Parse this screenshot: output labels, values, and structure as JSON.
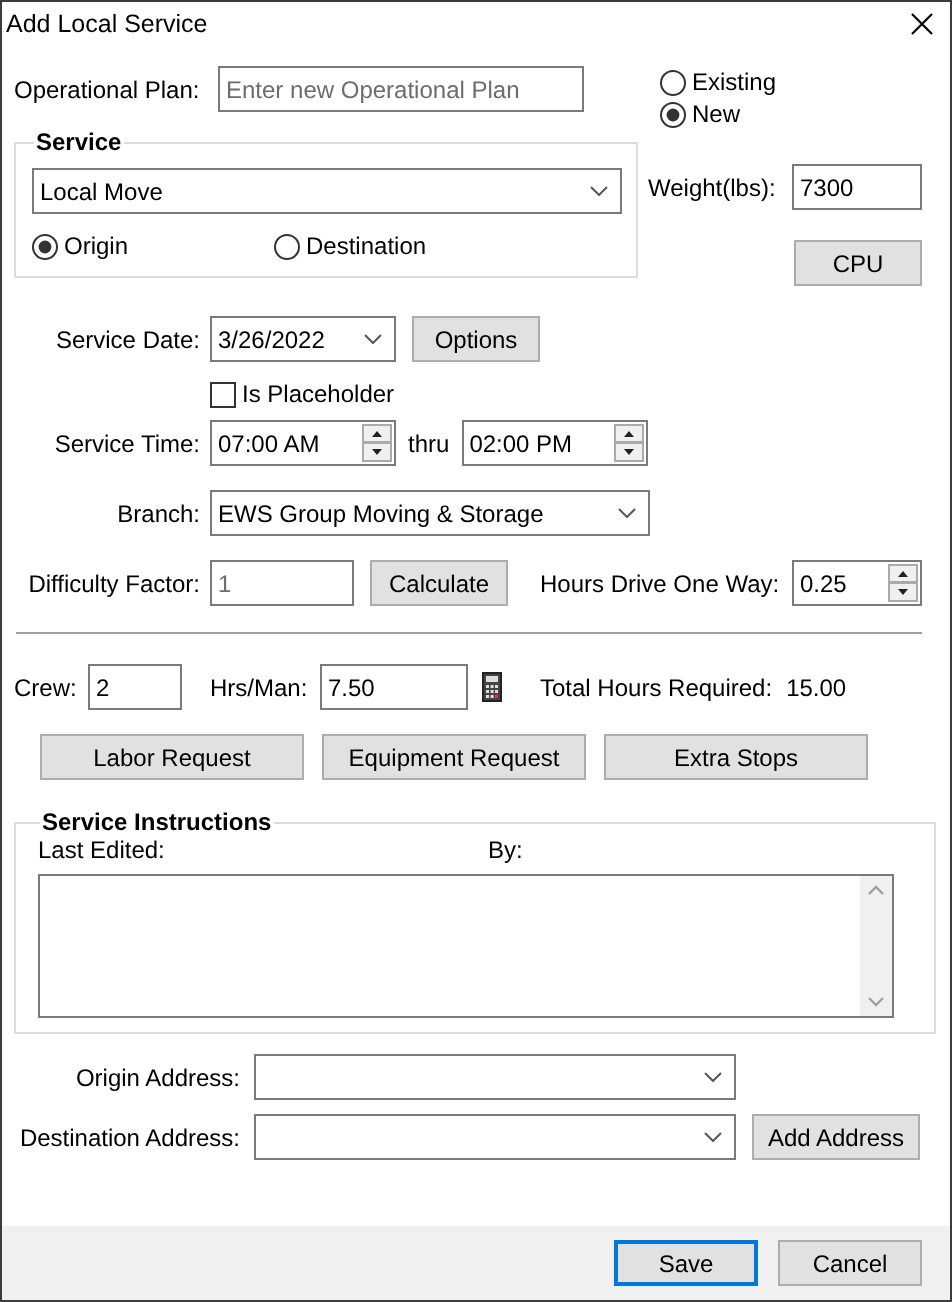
{
  "window": {
    "title": "Add Local Service"
  },
  "operational_plan": {
    "label": "Operational Plan:",
    "placeholder": "Enter new Operational Plan"
  },
  "plan_mode": [
    {
      "label": "Existing",
      "selected": false
    },
    {
      "label": "New",
      "selected": true
    }
  ],
  "service": {
    "title": "Service",
    "type": "Local Move",
    "location": [
      {
        "label": "Origin",
        "selected": true
      },
      {
        "label": "Destination",
        "selected": false
      }
    ]
  },
  "weight": {
    "label": "Weight(lbs):",
    "value": "7300"
  },
  "cpu_button": "CPU",
  "service_date": {
    "label": "Service Date:",
    "value": "3/26/2022"
  },
  "options_button": "Options",
  "is_placeholder": {
    "label": "Is Placeholder",
    "checked": false
  },
  "service_time": {
    "label": "Service Time:",
    "from": "07:00 AM",
    "thru": "thru",
    "to": "02:00 PM"
  },
  "branch": {
    "label": "Branch:",
    "value": "EWS Group Moving & Storage"
  },
  "difficulty": {
    "label": "Difficulty Factor:",
    "placeholder": "1"
  },
  "calculate_button": "Calculate",
  "hours_drive": {
    "label": "Hours Drive One Way:",
    "value": "0.25"
  },
  "crew": {
    "label": "Crew:",
    "value": "2"
  },
  "hrs_man": {
    "label": "Hrs/Man:",
    "value": "7.50"
  },
  "total_hours": {
    "label": "Total Hours Required:",
    "value": "15.00"
  },
  "request_buttons": [
    "Labor Request",
    "Equipment Request",
    "Extra Stops"
  ],
  "instructions": {
    "title": "Service Instructions",
    "last_edited": "Last Edited:",
    "by": "By:"
  },
  "origin_address": {
    "label": "Origin Address:"
  },
  "destination_address": {
    "label": "Destination Address:"
  },
  "add_address_button": "Add Address",
  "footer_buttons": [
    {
      "label": "Save",
      "default": true
    },
    {
      "label": "Cancel",
      "default": false
    }
  ]
}
